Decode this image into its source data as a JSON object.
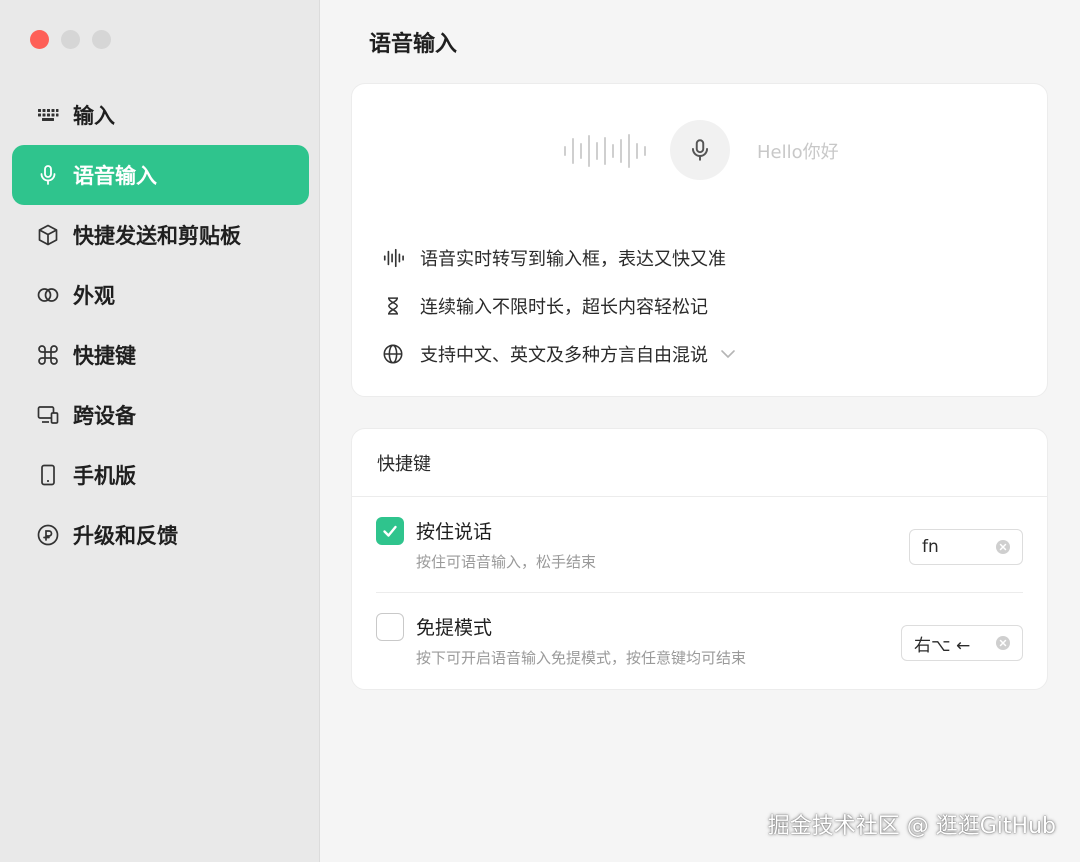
{
  "window": {
    "controls": [
      "close",
      "minimize",
      "maximize"
    ]
  },
  "sidebar": {
    "items": [
      {
        "label": "输入",
        "icon": "keyboard-icon",
        "active": false
      },
      {
        "label": "语音输入",
        "icon": "microphone-icon",
        "active": true
      },
      {
        "label": "快捷发送和剪贴板",
        "icon": "cube-icon",
        "active": false
      },
      {
        "label": "外观",
        "icon": "overlap-circles-icon",
        "active": false
      },
      {
        "label": "快捷键",
        "icon": "command-icon",
        "active": false
      },
      {
        "label": "跨设备",
        "icon": "devices-icon",
        "active": false
      },
      {
        "label": "手机版",
        "icon": "phone-icon",
        "active": false
      },
      {
        "label": "升级和反馈",
        "icon": "upgrade-icon",
        "active": false
      }
    ]
  },
  "main": {
    "title": "语音输入",
    "demo": {
      "sample_text": "Hello你好"
    },
    "features": [
      {
        "icon": "waveform-icon",
        "text": "语音实时转写到输入框，表达又快又准"
      },
      {
        "icon": "hourglass-icon",
        "text": "连续输入不限时长，超长内容轻松记"
      },
      {
        "icon": "globe-icon",
        "text": "支持中文、英文及多种方言自由混说"
      }
    ],
    "shortcuts": {
      "title": "快捷键",
      "rows": [
        {
          "label": "按住说话",
          "desc": "按住可语音输入，松手结束",
          "checked": true,
          "key": "fn"
        },
        {
          "label": "免提模式",
          "desc": "按下可开启语音输入免提模式，按任意键均可结束",
          "checked": false,
          "key": "右⌥ ←"
        }
      ]
    }
  },
  "watermark": "掘金技术社区 @ 逛逛GitHub",
  "colors": {
    "accent": "#2fc48d",
    "sidebar_bg": "#e9e9e9",
    "close": "#fe5f57"
  }
}
